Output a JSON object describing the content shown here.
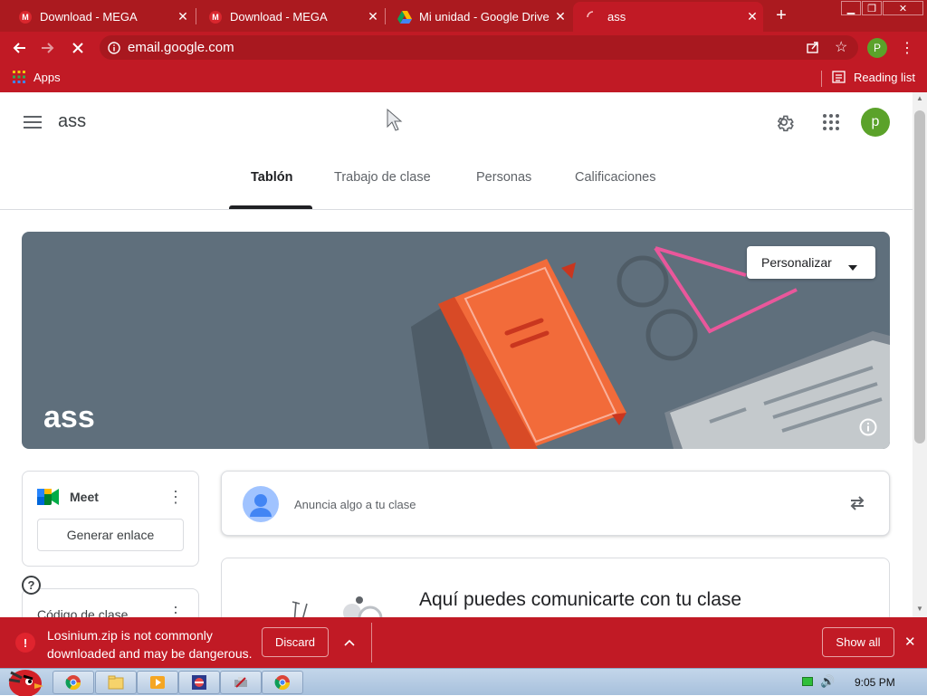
{
  "browser": {
    "tabs": [
      {
        "title": "Download - MEGA",
        "icon": "mega-icon"
      },
      {
        "title": "Download - MEGA",
        "icon": "mega-icon"
      },
      {
        "title": "Mi unidad - Google Drive",
        "icon": "google-drive-icon"
      },
      {
        "title": "ass",
        "icon": "loading-spinner-icon"
      }
    ],
    "url": "email.google.com",
    "profile_initial": "P",
    "bookmarks": {
      "apps_label": "Apps",
      "reading_list_label": "Reading list"
    }
  },
  "classroom": {
    "class_name": "ass",
    "nav_tabs": [
      "Tablón",
      "Trabajo de clase",
      "Personas",
      "Calificaciones"
    ],
    "active_tab": "Tablón",
    "banner_title": "ass",
    "customize_label": "Personalizar",
    "meet": {
      "title": "Meet",
      "generate_link_label": "Generar enlace"
    },
    "class_code_label": "Código de clase",
    "announce_placeholder": "Anuncia algo a tu clase",
    "communicate_heading": "Aquí puedes comunicarte con tu clase",
    "user_initial": "p"
  },
  "download_bar": {
    "warning_line1": "Losinium.zip is not commonly",
    "warning_line2": "downloaded and may be dangerous.",
    "discard_label": "Discard",
    "show_all_label": "Show all"
  },
  "taskbar": {
    "clock": "9:05 PM"
  },
  "colors": {
    "browser_accent": "#c11a25",
    "classroom_green": "#1e8e3e",
    "avatar_green": "#5ba22a",
    "banner_bg": "#5f6f7c",
    "book_orange": "#f26b3a"
  }
}
